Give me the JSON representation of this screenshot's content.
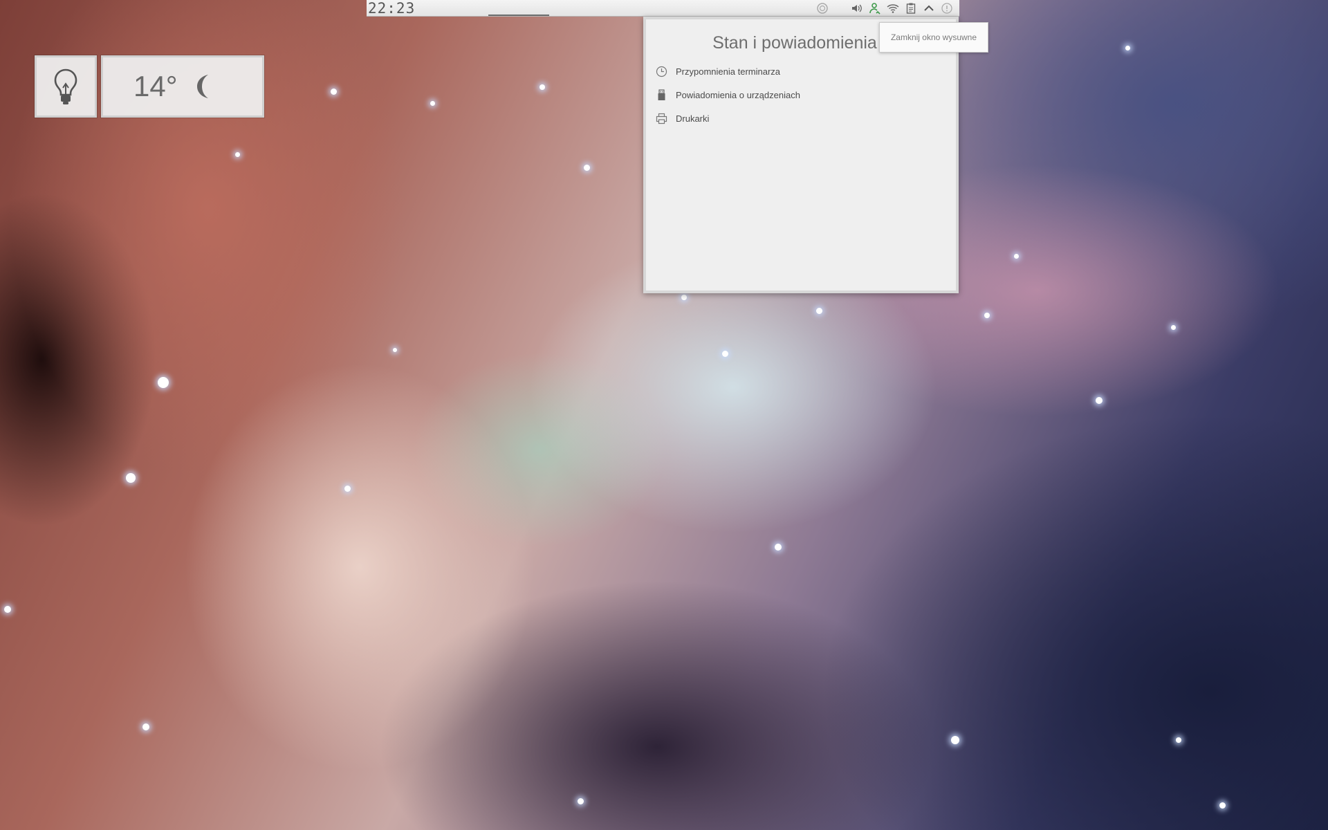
{
  "panel": {
    "clock": "22:23",
    "tray_icons": [
      "circle-status-icon",
      "volume-icon",
      "user-network-icon",
      "wifi-icon",
      "clipboard-icon",
      "chevron-up-icon",
      "info-icon"
    ]
  },
  "notifications_popup": {
    "title": "Stan i powiadomienia",
    "items": [
      {
        "label": "Przypomnienia terminarza",
        "icon": "clock-icon"
      },
      {
        "label": "Powiadomienia o urządzeniach",
        "icon": "usb-device-icon"
      },
      {
        "label": "Drukarki",
        "icon": "printer-icon"
      }
    ]
  },
  "tooltip": {
    "text": "Zamknij okno wysuwne"
  },
  "widgets": {
    "bulb": {
      "icon": "lightbulb-icon"
    },
    "weather": {
      "temperature": "14°",
      "icon": "moon-icon"
    }
  }
}
